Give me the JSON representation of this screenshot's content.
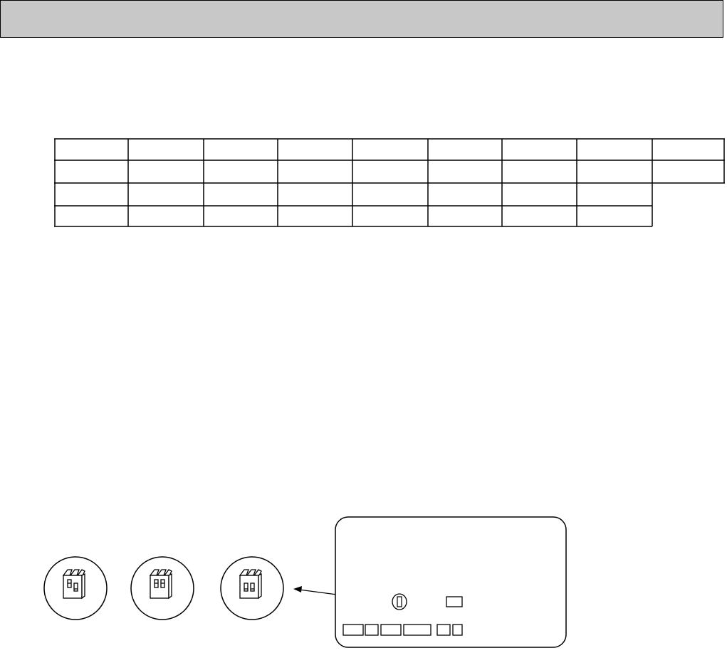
{
  "header": {
    "title": ""
  },
  "table": {
    "rows": [
      [
        "",
        "",
        "",
        "",
        "",
        "",
        "",
        "",
        ""
      ],
      [
        "",
        "",
        "",
        "",
        "",
        "",
        "",
        "",
        ""
      ],
      [
        "",
        "",
        "",
        "",
        "",
        "",
        "",
        ""
      ],
      [
        "",
        "",
        "",
        "",
        "",
        "",
        "",
        ""
      ]
    ]
  },
  "diagram": {
    "switch_settings": [
      {
        "icon": "dip-switch-icon"
      },
      {
        "icon": "dip-switch-icon"
      },
      {
        "icon": "dip-switch-icon"
      }
    ],
    "board": {
      "icon": "circuit-board-icon"
    }
  }
}
